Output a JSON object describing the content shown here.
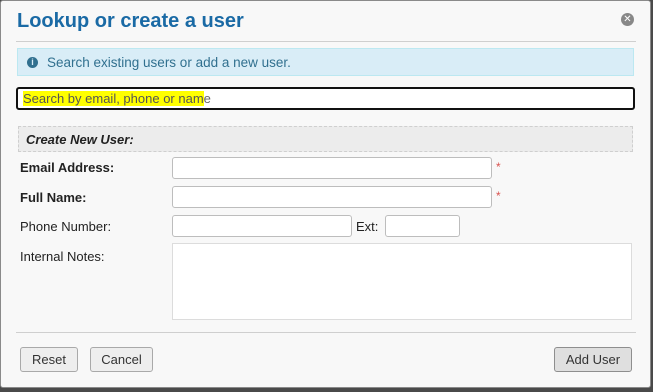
{
  "dialog": {
    "title": "Lookup or create a user",
    "close_icon": "close-circle-icon"
  },
  "info": {
    "icon": "info-icon",
    "text": "Search existing users or add a new user."
  },
  "search": {
    "placeholder_highlighted": "Search by email, phone or nam",
    "placeholder_rest": "e"
  },
  "create": {
    "section_title": "Create New User:",
    "email_label": "Email Address:",
    "name_label": "Full Name:",
    "phone_label": "Phone Number:",
    "ext_label": "Ext:",
    "notes_label": "Internal Notes:",
    "required_mark": "*"
  },
  "footer": {
    "reset_label": "Reset",
    "cancel_label": "Cancel",
    "add_label": "Add User"
  }
}
